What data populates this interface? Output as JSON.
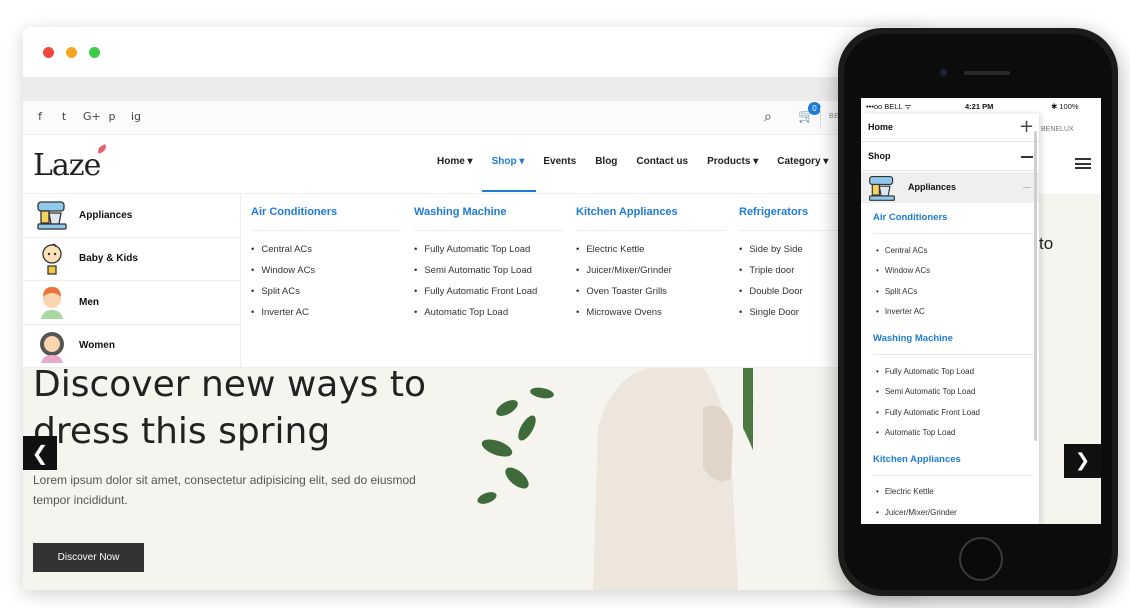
{
  "browser": {
    "social_icons": [
      "f",
      "t",
      "G+",
      "p",
      "ig"
    ],
    "cart_count": "0",
    "language": "BEL",
    "logo": "Laze",
    "nav": [
      "Home ▾",
      "Shop ▾",
      "Events",
      "Blog",
      "Contact us",
      "Products ▾",
      "Category ▾"
    ],
    "active_nav": "Shop",
    "categories": [
      "Appliances",
      "Baby & Kids",
      "Men",
      "Women"
    ],
    "columns": [
      {
        "title": "Air Conditioners",
        "items": [
          "Central ACs",
          "Window ACs",
          "Split ACs",
          "Inverter AC"
        ]
      },
      {
        "title": "Washing Machine",
        "items": [
          "Fully Automatic Top Load",
          "Semi Automatic Top Load",
          "Fully Automatic Front Load",
          "Automatic Top Load"
        ]
      },
      {
        "title": "Kitchen Appliances",
        "items": [
          "Electric Kettle",
          "Juicer/Mixer/Grinder",
          "Oven Toaster Grills",
          "Microwave Ovens"
        ]
      },
      {
        "title": "Refrigerators",
        "items": [
          "Side by Side",
          "Triple door",
          "Double Door",
          "Single Door"
        ]
      }
    ],
    "hero": {
      "title": "Discover new ways to dress this spring",
      "text": "Lorem ipsum dolor sit amet, consectetur adipisicing elit, sed do eiusmod tempor incididunt.",
      "button": "Discover Now",
      "prev": "❮"
    }
  },
  "phone": {
    "status_left": "•••oo BELL ᯤ",
    "status_time": "4:21 PM",
    "status_right": "✱ 100%",
    "menu_home": "Home",
    "menu_shop": "Shop",
    "menu_category": "Appliances",
    "lang": "BENELUX",
    "hero_fragment": "to",
    "next": "❯",
    "sections": [
      {
        "title": "Air Conditioners",
        "items": [
          "Central ACs",
          "Window ACs",
          "Split ACs",
          "Inverter AC"
        ]
      },
      {
        "title": "Washing Machine",
        "items": [
          "Fully Automatic Top Load",
          "Semi Automatic Top Load",
          "Fully Automatic Front Load",
          "Automatic Top Load"
        ]
      },
      {
        "title": "Kitchen Appliances",
        "items": [
          "Electric Kettle",
          "Juicer/Mixer/Grinder"
        ]
      }
    ]
  },
  "colors": {
    "accent": "#1d7bd6",
    "dark": "#222222",
    "hero_bg": "#f6f4ef"
  }
}
